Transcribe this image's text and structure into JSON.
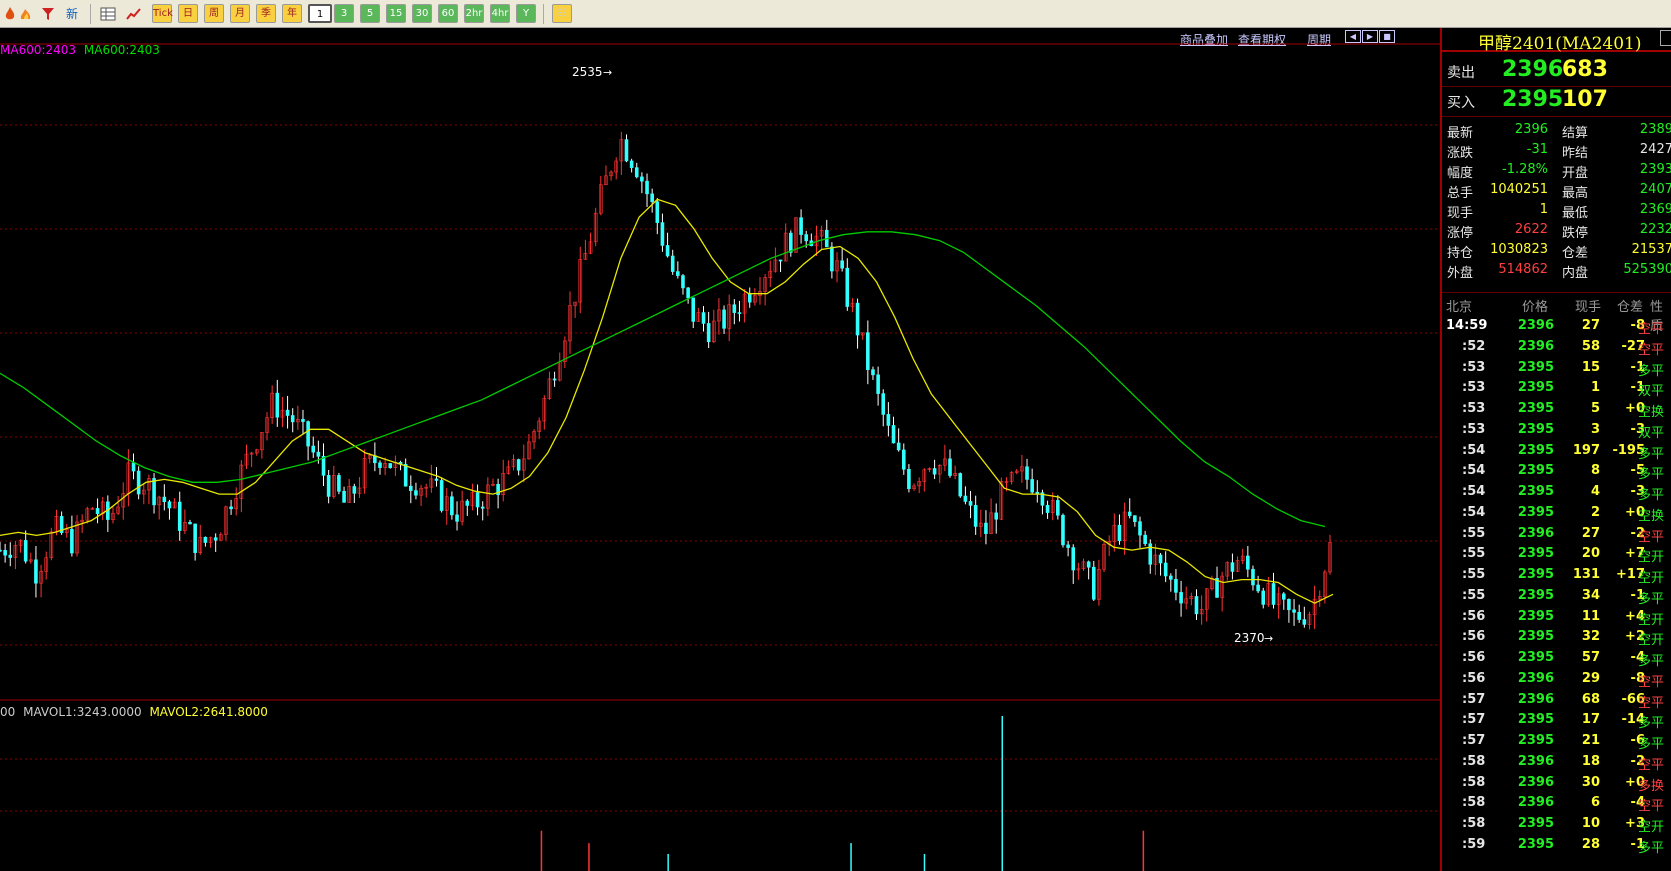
{
  "toolbar": {
    "icons": [
      "flame-icon",
      "fire-icon",
      "filter-icon",
      "new-icon",
      "table-icon",
      "trend-icon"
    ],
    "period_buttons": [
      "Tick",
      "日",
      "周",
      "月",
      "季",
      "年",
      "1",
      "3",
      "5",
      "15",
      "30",
      "60",
      "2hr",
      "4hr",
      "Y"
    ],
    "active_period": "1"
  },
  "chart": {
    "links": [
      "商品叠加",
      "查看期权",
      "周期"
    ],
    "ma_label_1": "MA600:2403",
    "ma_label_2": "MA600:2403",
    "high_label": "2535",
    "low_label": "2370",
    "vol_prefix": "00",
    "mavol1": "MAVOL1:3243.0000",
    "mavol2": "MAVOL2:2641.8000",
    "colors": {
      "up": "#ff3333",
      "down": "#33ffff",
      "ma_fast": "#e8e800",
      "ma_slow": "#00cc00",
      "grid": "#8b0000"
    }
  },
  "chart_data": {
    "type": "candlestick",
    "symbol": "MA2401",
    "high": 2535,
    "low": 2370,
    "ma600": 2403,
    "close_path": [
      2395,
      2398,
      2388,
      2402,
      2398,
      2410,
      2405,
      2420,
      2418,
      2412,
      2404,
      2396,
      2402,
      2418,
      2432,
      2445,
      2440,
      2430,
      2418,
      2410,
      2422,
      2428,
      2420,
      2418,
      2414,
      2408,
      2410,
      2416,
      2420,
      2430,
      2448,
      2470,
      2492,
      2515,
      2535,
      2525,
      2508,
      2488,
      2475,
      2470,
      2474,
      2482,
      2490,
      2498,
      2505,
      2500,
      2490,
      2472,
      2450,
      2430,
      2418,
      2426,
      2422,
      2410,
      2400,
      2414,
      2420,
      2418,
      2405,
      2392,
      2382,
      2400,
      2405,
      2395,
      2386,
      2380,
      2375,
      2386,
      2392,
      2384,
      2376,
      2372,
      2375,
      2396
    ],
    "ma_fast_path": [
      2400,
      2401,
      2400,
      2401,
      2403,
      2405,
      2409,
      2414,
      2418,
      2419,
      2418,
      2416,
      2414,
      2414,
      2418,
      2425,
      2432,
      2436,
      2436,
      2432,
      2428,
      2426,
      2424,
      2422,
      2420,
      2417,
      2415,
      2414,
      2416,
      2420,
      2428,
      2440,
      2456,
      2474,
      2494,
      2508,
      2514,
      2512,
      2504,
      2494,
      2486,
      2482,
      2482,
      2486,
      2492,
      2497,
      2498,
      2494,
      2486,
      2474,
      2460,
      2448,
      2440,
      2432,
      2424,
      2416,
      2414,
      2414,
      2413,
      2408,
      2400,
      2396,
      2395,
      2396,
      2395,
      2391,
      2386,
      2384,
      2385,
      2385,
      2384,
      2380,
      2377,
      2380
    ],
    "ma_slow_path": [
      2455,
      2450,
      2444,
      2438,
      2432,
      2427,
      2423,
      2420,
      2418,
      2418,
      2419,
      2421,
      2423,
      2425,
      2428,
      2431,
      2434,
      2437,
      2440,
      2443,
      2446,
      2450,
      2454,
      2458,
      2462,
      2466,
      2470,
      2474,
      2478,
      2482,
      2486,
      2490,
      2494,
      2497,
      2500,
      2502,
      2503,
      2503,
      2502,
      2500,
      2496,
      2490,
      2484,
      2478,
      2471,
      2464,
      2456,
      2448,
      2440,
      2432,
      2425,
      2420,
      2414,
      2409,
      2405,
      2403
    ],
    "volume_spikes": [
      {
        "pos": 0.376,
        "type": "up",
        "value": 0.26
      },
      {
        "pos": 0.409,
        "type": "up",
        "value": 0.18
      },
      {
        "pos": 0.464,
        "type": "down",
        "value": 0.11
      },
      {
        "pos": 0.591,
        "type": "down",
        "value": 0.18
      },
      {
        "pos": 0.642,
        "type": "down",
        "value": 0.11
      },
      {
        "pos": 0.696,
        "type": "down",
        "value": 1.0
      },
      {
        "pos": 0.794,
        "type": "up",
        "value": 0.26
      }
    ]
  },
  "quote": {
    "title": "甲醇2401(MA2401)",
    "sell": {
      "label": "卖出",
      "price": "2396",
      "vol": "683"
    },
    "buy": {
      "label": "买入",
      "price": "2395",
      "vol": "107"
    },
    "stats": [
      {
        "l1": "最新",
        "v1": "2396",
        "c1": "g",
        "l2": "结算",
        "v2": "2389",
        "c2": "g"
      },
      {
        "l1": "涨跌",
        "v1": "-31",
        "c1": "g",
        "l2": "昨结",
        "v2": "2427",
        "c2": "w"
      },
      {
        "l1": "幅度",
        "v1": "-1.28%",
        "c1": "g",
        "l2": "开盘",
        "v2": "2393",
        "c2": "g"
      },
      {
        "l1": "总手",
        "v1": "1040251",
        "c1": "y",
        "l2": "最高",
        "v2": "2407",
        "c2": "g"
      },
      {
        "l1": "现手",
        "v1": "1",
        "c1": "y",
        "l2": "最低",
        "v2": "2369",
        "c2": "g"
      },
      {
        "l1": "涨停",
        "v1": "2622",
        "c1": "r",
        "l2": "跌停",
        "v2": "2232",
        "c2": "g"
      },
      {
        "l1": "持仓",
        "v1": "1030823",
        "c1": "y",
        "l2": "仓差",
        "v2": "21537",
        "c2": "y"
      },
      {
        "l1": "外盘",
        "v1": "514862",
        "c1": "r",
        "l2": "内盘",
        "v2": "525390",
        "c2": "g"
      }
    ],
    "trade_header": [
      "北京",
      "价格",
      "现手",
      "仓差",
      "性质"
    ],
    "trades": [
      {
        "t": "14:59",
        "p": "2396",
        "q": "27",
        "d": "-8",
        "n": "空平",
        "pc": "g",
        "nc": "r"
      },
      {
        "t": ":52",
        "p": "2396",
        "q": "58",
        "d": "-27",
        "n": "空平",
        "pc": "g",
        "nc": "r"
      },
      {
        "t": ":53",
        "p": "2395",
        "q": "15",
        "d": "-1",
        "n": "多平",
        "pc": "g",
        "nc": "g"
      },
      {
        "t": ":53",
        "p": "2395",
        "q": "1",
        "d": "-1",
        "n": "双平",
        "pc": "g",
        "nc": "g"
      },
      {
        "t": ":53",
        "p": "2395",
        "q": "5",
        "d": "+0",
        "n": "空换",
        "pc": "g",
        "nc": "g"
      },
      {
        "t": ":53",
        "p": "2395",
        "q": "3",
        "d": "-3",
        "n": "双平",
        "pc": "g",
        "nc": "g"
      },
      {
        "t": ":54",
        "p": "2395",
        "q": "197",
        "d": "-195",
        "n": "多平",
        "pc": "g",
        "nc": "g"
      },
      {
        "t": ":54",
        "p": "2395",
        "q": "8",
        "d": "-5",
        "n": "多平",
        "pc": "g",
        "nc": "g"
      },
      {
        "t": ":54",
        "p": "2395",
        "q": "4",
        "d": "-3",
        "n": "多平",
        "pc": "g",
        "nc": "g"
      },
      {
        "t": ":54",
        "p": "2395",
        "q": "2",
        "d": "+0",
        "n": "空换",
        "pc": "g",
        "nc": "g"
      },
      {
        "t": ":55",
        "p": "2396",
        "q": "27",
        "d": "-2",
        "n": "空平",
        "pc": "g",
        "nc": "r"
      },
      {
        "t": ":55",
        "p": "2395",
        "q": "20",
        "d": "+7",
        "n": "空开",
        "pc": "g",
        "nc": "g"
      },
      {
        "t": ":55",
        "p": "2395",
        "q": "131",
        "d": "+17",
        "n": "空开",
        "pc": "g",
        "nc": "g"
      },
      {
        "t": ":55",
        "p": "2395",
        "q": "34",
        "d": "-1",
        "n": "多平",
        "pc": "g",
        "nc": "g"
      },
      {
        "t": ":56",
        "p": "2395",
        "q": "11",
        "d": "+4",
        "n": "空开",
        "pc": "g",
        "nc": "g"
      },
      {
        "t": ":56",
        "p": "2395",
        "q": "32",
        "d": "+2",
        "n": "空开",
        "pc": "g",
        "nc": "g"
      },
      {
        "t": ":56",
        "p": "2395",
        "q": "57",
        "d": "-4",
        "n": "多平",
        "pc": "g",
        "nc": "g"
      },
      {
        "t": ":56",
        "p": "2396",
        "q": "29",
        "d": "-8",
        "n": "空平",
        "pc": "g",
        "nc": "r"
      },
      {
        "t": ":57",
        "p": "2396",
        "q": "68",
        "d": "-66",
        "n": "空平",
        "pc": "g",
        "nc": "r"
      },
      {
        "t": ":57",
        "p": "2395",
        "q": "17",
        "d": "-14",
        "n": "多平",
        "pc": "g",
        "nc": "g"
      },
      {
        "t": ":57",
        "p": "2395",
        "q": "21",
        "d": "-6",
        "n": "多平",
        "pc": "g",
        "nc": "g"
      },
      {
        "t": ":58",
        "p": "2396",
        "q": "18",
        "d": "-2",
        "n": "空平",
        "pc": "g",
        "nc": "r"
      },
      {
        "t": ":58",
        "p": "2396",
        "q": "30",
        "d": "+0",
        "n": "多换",
        "pc": "g",
        "nc": "r"
      },
      {
        "t": ":58",
        "p": "2396",
        "q": "6",
        "d": "-4",
        "n": "空平",
        "pc": "g",
        "nc": "r"
      },
      {
        "t": ":58",
        "p": "2395",
        "q": "10",
        "d": "+3",
        "n": "空开",
        "pc": "g",
        "nc": "g"
      },
      {
        "t": ":59",
        "p": "2395",
        "q": "28",
        "d": "-1",
        "n": "多平",
        "pc": "g",
        "nc": "g"
      }
    ]
  }
}
